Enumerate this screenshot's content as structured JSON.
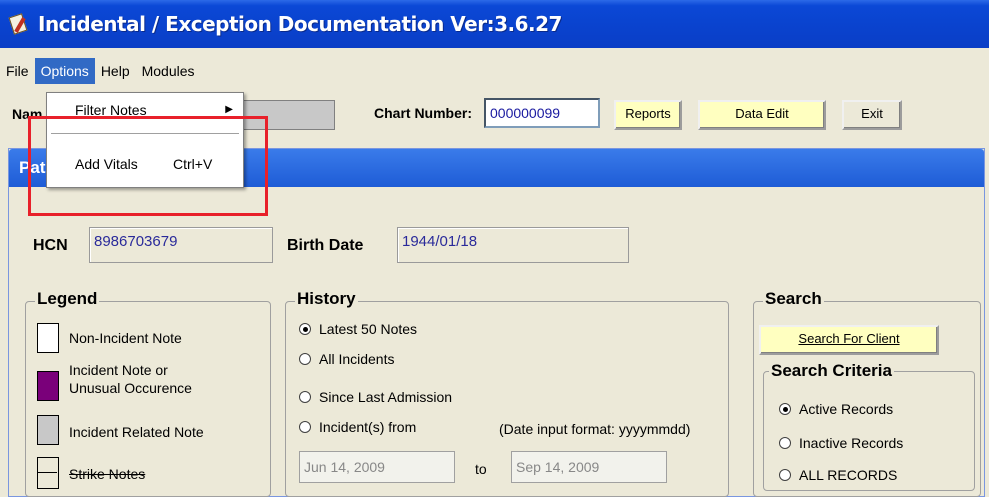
{
  "window": {
    "title": "Incidental / Exception Documentation Ver:3.6.27"
  },
  "menu": {
    "file": "File",
    "options": "Options",
    "help": "Help",
    "modules": "Modules"
  },
  "options_menu": {
    "filter_notes": "Filter Notes",
    "add_vitals": "Add Vitals",
    "add_vitals_shortcut": "Ctrl+V"
  },
  "toolbar": {
    "name_label": "Nam",
    "chart_number_label": "Chart Number:",
    "chart_number_value": "000000099",
    "reports": "Reports",
    "data_edit": "Data Edit",
    "exit": "Exit"
  },
  "panel": {
    "title": "Patient Selection",
    "hcn_label": "HCN",
    "hcn_value": "8986703679",
    "birth_date_label": "Birth Date",
    "birth_date_value": "1944/01/18"
  },
  "legend": {
    "title": "Legend",
    "items": [
      {
        "label": "Non-Incident Note",
        "color": "#ffffff"
      },
      {
        "label": "Incident Note or\nUnusual Occurence",
        "color": "#7a007a"
      },
      {
        "label": "Incident Related Note",
        "color": "#c8c8c8"
      },
      {
        "label": "Strike Notes",
        "color": "#ece9d8"
      }
    ]
  },
  "history": {
    "title": "History",
    "options": [
      "Latest 50 Notes",
      "All Incidents",
      "Since Last Admission",
      "Incident(s) from"
    ],
    "selected": 0,
    "date_format_hint": "(Date input format: yyyymmdd)",
    "from_date": "Jun 14, 2009",
    "to_label": "to",
    "to_date": "Sep 14, 2009"
  },
  "search": {
    "title": "Search",
    "button": "Search For Client",
    "criteria_title": "Search Criteria",
    "criteria": [
      "Active Records",
      "Inactive Records",
      "ALL RECORDS"
    ],
    "selected": 0
  },
  "colors": {
    "accent": "#0a42cd",
    "highlight_box": "#e8202a",
    "button_yellow": "#ffffc0"
  }
}
